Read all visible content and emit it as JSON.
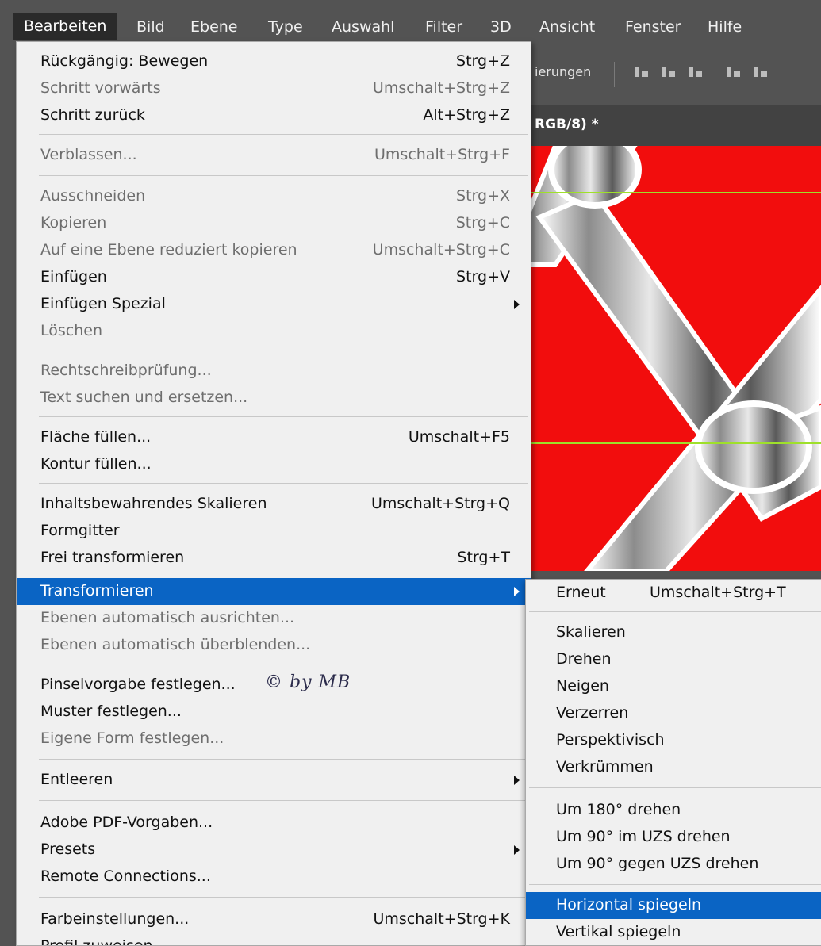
{
  "menubar": {
    "items": [
      "Bearbeiten",
      "Bild",
      "Ebene",
      "Type",
      "Auswahl",
      "Filter",
      "3D",
      "Ansicht",
      "Fenster",
      "Hilfe"
    ]
  },
  "optbar": {
    "label": "ierungen"
  },
  "doctab": {
    "title": "RGB/8) *"
  },
  "watermark": "© by MB",
  "menu": {
    "items": [
      {
        "label": "Rückgängig: Bewegen",
        "shortcut": "Strg+Z"
      },
      {
        "label": "Schritt vorwärts",
        "shortcut": "Umschalt+Strg+Z"
      },
      {
        "label": "Schritt zurück",
        "shortcut": "Alt+Strg+Z"
      },
      {
        "label": "Verblassen...",
        "shortcut": "Umschalt+Strg+F"
      },
      {
        "label": "Ausschneiden",
        "shortcut": "Strg+X"
      },
      {
        "label": "Kopieren",
        "shortcut": "Strg+C"
      },
      {
        "label": "Auf eine Ebene reduziert kopieren",
        "shortcut": "Umschalt+Strg+C"
      },
      {
        "label": "Einfügen",
        "shortcut": "Strg+V"
      },
      {
        "label": "Einfügen Spezial",
        "shortcut": ""
      },
      {
        "label": "Löschen",
        "shortcut": ""
      },
      {
        "label": "Rechtschreibprüfung...",
        "shortcut": ""
      },
      {
        "label": "Text suchen und ersetzen...",
        "shortcut": ""
      },
      {
        "label": "Fläche füllen...",
        "shortcut": "Umschalt+F5"
      },
      {
        "label": "Kontur füllen...",
        "shortcut": ""
      },
      {
        "label": "Inhaltsbewahrendes Skalieren",
        "shortcut": "Umschalt+Strg+Q"
      },
      {
        "label": "Formgitter",
        "shortcut": ""
      },
      {
        "label": "Frei transformieren",
        "shortcut": "Strg+T"
      },
      {
        "label": "Transformieren",
        "shortcut": ""
      },
      {
        "label": "Ebenen automatisch ausrichten...",
        "shortcut": ""
      },
      {
        "label": "Ebenen automatisch überblenden...",
        "shortcut": ""
      },
      {
        "label": "Pinselvorgabe festlegen...",
        "shortcut": ""
      },
      {
        "label": "Muster festlegen...",
        "shortcut": ""
      },
      {
        "label": "Eigene Form festlegen...",
        "shortcut": ""
      },
      {
        "label": "Entleeren",
        "shortcut": ""
      },
      {
        "label": "Adobe PDF-Vorgaben...",
        "shortcut": ""
      },
      {
        "label": "Presets",
        "shortcut": ""
      },
      {
        "label": "Remote Connections...",
        "shortcut": ""
      },
      {
        "label": "Farbeinstellungen...",
        "shortcut": "Umschalt+Strg+K"
      },
      {
        "label": "Profil zuweisen...",
        "shortcut": ""
      }
    ]
  },
  "submenu": {
    "items": [
      {
        "label": "Erneut",
        "shortcut": "Umschalt+Strg+T"
      },
      {
        "label": "Skalieren",
        "shortcut": ""
      },
      {
        "label": "Drehen",
        "shortcut": ""
      },
      {
        "label": "Neigen",
        "shortcut": ""
      },
      {
        "label": "Verzerren",
        "shortcut": ""
      },
      {
        "label": "Perspektivisch",
        "shortcut": ""
      },
      {
        "label": "Verkrümmen",
        "shortcut": ""
      },
      {
        "label": "Um 180° drehen",
        "shortcut": ""
      },
      {
        "label": "Um 90° im UZS drehen",
        "shortcut": ""
      },
      {
        "label": "Um 90° gegen UZS drehen",
        "shortcut": ""
      },
      {
        "label": "Horizontal spiegeln",
        "shortcut": ""
      },
      {
        "label": "Vertikal spiegeln",
        "shortcut": ""
      }
    ]
  },
  "colors": {
    "highlight": "#0a64c4",
    "canvas_red": "#f20d0d",
    "guide": "#9fe02a"
  }
}
